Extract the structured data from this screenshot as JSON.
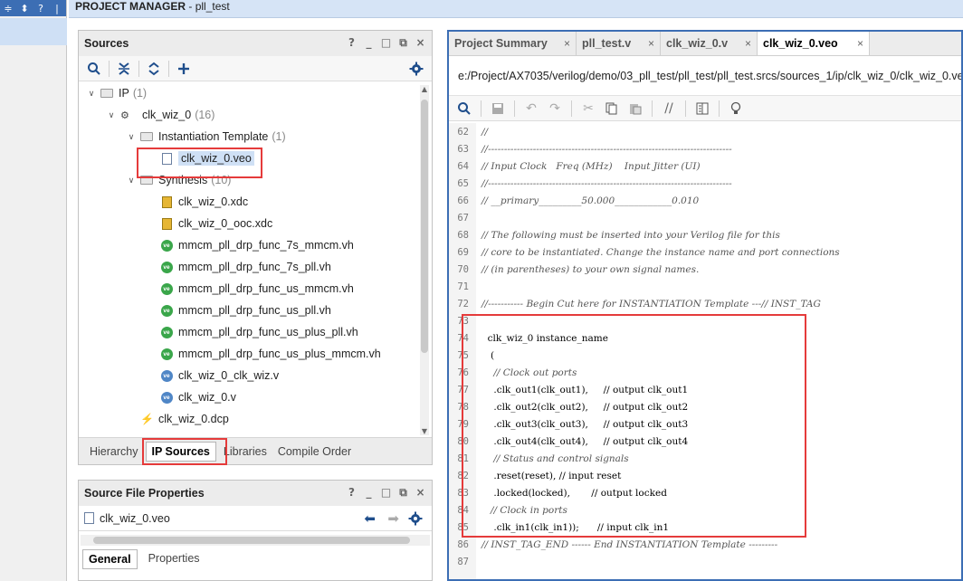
{
  "header": {
    "section": "PROJECT MANAGER",
    "project": "pll_test",
    "separator": " - "
  },
  "left_strip": {
    "icons": [
      "collapse-icon",
      "expand-icon",
      "help-icon",
      "close-icon"
    ]
  },
  "sources": {
    "title": "Sources",
    "ctrls": [
      "?",
      "_",
      "□",
      "⧉",
      "×"
    ],
    "tree": [
      {
        "label": "IP",
        "count": "(1)",
        "indent": 0,
        "toggle": "∨",
        "icon": "folder"
      },
      {
        "label": "clk_wiz_0",
        "count": "(16)",
        "indent": 1,
        "toggle": "∨",
        "icon": "ip"
      },
      {
        "label": "Instantiation Template",
        "count": "(1)",
        "indent": 2,
        "toggle": "∨",
        "icon": "folder"
      },
      {
        "label": "clk_wiz_0.veo",
        "count": "",
        "indent": 3,
        "toggle": "",
        "icon": "file",
        "selected": true
      },
      {
        "label": "Synthesis",
        "count": "(10)",
        "indent": 2,
        "toggle": "∨",
        "icon": "folder"
      },
      {
        "label": "clk_wiz_0.xdc",
        "count": "",
        "indent": 3,
        "toggle": "",
        "icon": "xdc"
      },
      {
        "label": "clk_wiz_0_ooc.xdc",
        "count": "",
        "indent": 3,
        "toggle": "",
        "icon": "xdc"
      },
      {
        "label": "mmcm_pll_drp_func_7s_mmcm.vh",
        "count": "",
        "indent": 3,
        "toggle": "",
        "icon": "vh"
      },
      {
        "label": "mmcm_pll_drp_func_7s_pll.vh",
        "count": "",
        "indent": 3,
        "toggle": "",
        "icon": "vh"
      },
      {
        "label": "mmcm_pll_drp_func_us_mmcm.vh",
        "count": "",
        "indent": 3,
        "toggle": "",
        "icon": "vh"
      },
      {
        "label": "mmcm_pll_drp_func_us_pll.vh",
        "count": "",
        "indent": 3,
        "toggle": "",
        "icon": "vh"
      },
      {
        "label": "mmcm_pll_drp_func_us_plus_pll.vh",
        "count": "",
        "indent": 3,
        "toggle": "",
        "icon": "vh"
      },
      {
        "label": "mmcm_pll_drp_func_us_plus_mmcm.vh",
        "count": "",
        "indent": 3,
        "toggle": "",
        "icon": "vh"
      },
      {
        "label": "clk_wiz_0_clk_wiz.v",
        "count": "",
        "indent": 3,
        "toggle": "",
        "icon": "v"
      },
      {
        "label": "clk_wiz_0.v",
        "count": "",
        "indent": 3,
        "toggle": "",
        "icon": "v"
      },
      {
        "label": "clk_wiz_0.dcp",
        "count": "",
        "indent": 2,
        "toggle": "",
        "icon": "dcp"
      }
    ],
    "tabs": [
      "Hierarchy",
      "IP Sources",
      "Libraries",
      "Compile Order"
    ],
    "active_tab": "IP Sources"
  },
  "file_props": {
    "title": "Source File Properties",
    "ctrls": [
      "?",
      "_",
      "□",
      "⧉",
      "×"
    ],
    "file": "clk_wiz_0.veo",
    "tabs": [
      "General",
      "Properties"
    ]
  },
  "editor": {
    "tabs": [
      {
        "label": "Project Summary",
        "close": "×"
      },
      {
        "label": "pll_test.v",
        "close": "×"
      },
      {
        "label": "clk_wiz_0.v",
        "close": "×"
      },
      {
        "label": "clk_wiz_0.veo",
        "close": "×",
        "active": true
      }
    ],
    "path": "e:/Project/AX7035/verilog/demo/03_pll_test/pll_test/pll_test.srcs/sources_1/ip/clk_wiz_0/clk_wiz_0.veo",
    "lines": [
      {
        "n": "62",
        "t": "//",
        "c": true
      },
      {
        "n": "63",
        "t": "//----------------------------------------------------------------------------",
        "c": true
      },
      {
        "n": "64",
        "t": "// Input Clock   Freq (MHz)    Input Jitter (UI)",
        "c": true
      },
      {
        "n": "65",
        "t": "//----------------------------------------------------------------------------",
        "c": true
      },
      {
        "n": "66",
        "t": "// __primary_________50.000____________0.010",
        "c": true
      },
      {
        "n": "67",
        "t": "",
        "c": false
      },
      {
        "n": "68",
        "t": "// The following must be inserted into your Verilog file for this",
        "c": true
      },
      {
        "n": "69",
        "t": "// core to be instantiated. Change the instance name and port connections",
        "c": true
      },
      {
        "n": "70",
        "t": "// (in parentheses) to your own signal names.",
        "c": true
      },
      {
        "n": "71",
        "t": "",
        "c": false
      },
      {
        "n": "72",
        "t": "//----------- Begin Cut here for INSTANTIATION Template ---// INST_TAG",
        "c": true
      },
      {
        "n": "73",
        "t": "",
        "c": false
      },
      {
        "n": "74",
        "t": "  clk_wiz_0 instance_name",
        "c": false
      },
      {
        "n": "75",
        "t": "   (",
        "c": false
      },
      {
        "n": "76",
        "t": "    // Clock out ports",
        "c": true
      },
      {
        "n": "77",
        "t": "    .clk_out1(clk_out1),     // output clk_out1",
        "c": false
      },
      {
        "n": "78",
        "t": "    .clk_out2(clk_out2),     // output clk_out2",
        "c": false
      },
      {
        "n": "79",
        "t": "    .clk_out3(clk_out3),     // output clk_out3",
        "c": false
      },
      {
        "n": "80",
        "t": "    .clk_out4(clk_out4),     // output clk_out4",
        "c": false
      },
      {
        "n": "81",
        "t": "    // Status and control signals",
        "c": true
      },
      {
        "n": "82",
        "t": "    .reset(reset), // input reset",
        "c": false
      },
      {
        "n": "83",
        "t": "    .locked(locked),       // output locked",
        "c": false
      },
      {
        "n": "84",
        "t": "   // Clock in ports",
        "c": true
      },
      {
        "n": "85",
        "t": "    .clk_in1(clk_in1));      // input clk_in1",
        "c": false
      },
      {
        "n": "86",
        "t": "// INST_TAG_END ------ End INSTANTIATION Template ---------",
        "c": true
      },
      {
        "n": "87",
        "t": "",
        "c": false
      }
    ]
  },
  "colors": {
    "accent": "#3c6eb4",
    "highlight": "#e53b3b",
    "selected": "#cfe0f5"
  }
}
